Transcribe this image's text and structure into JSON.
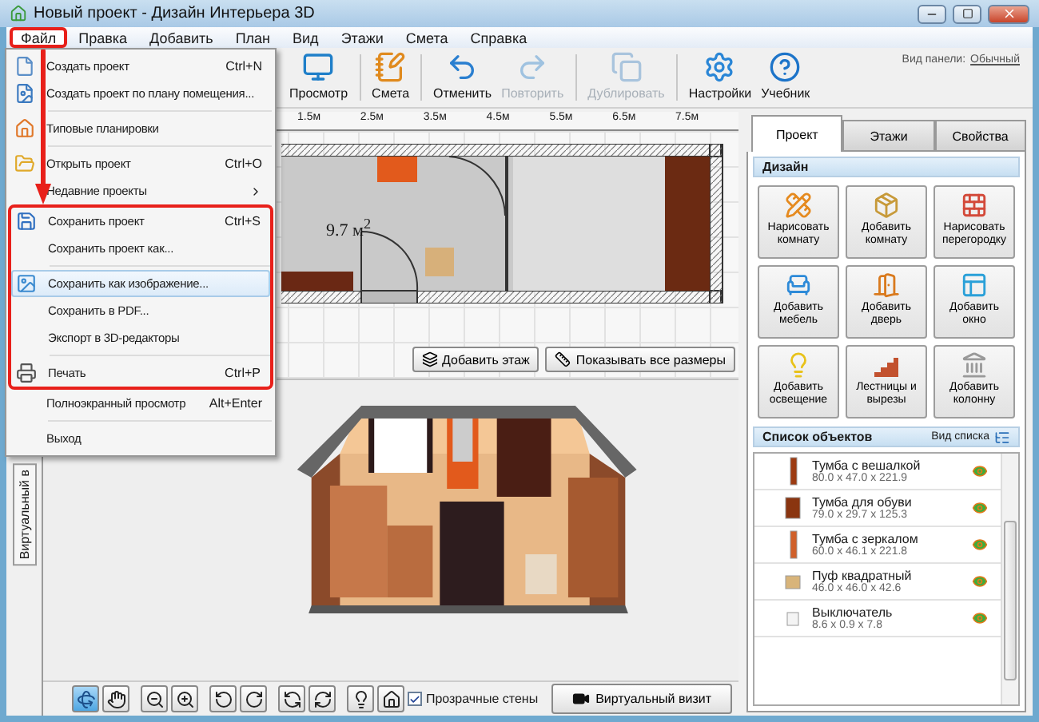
{
  "window": {
    "title": "Новый проект - Дизайн Интерьера 3D"
  },
  "menu_bar": [
    {
      "label": "Файл",
      "selected": true,
      "framed": true
    },
    {
      "label": "Правка",
      "selected": false,
      "framed": false
    },
    {
      "label": "Добавить",
      "selected": false,
      "framed": false
    },
    {
      "label": "План",
      "selected": false,
      "framed": false
    },
    {
      "label": "Вид",
      "selected": false,
      "framed": false
    },
    {
      "label": "Этажи",
      "selected": false,
      "framed": false
    },
    {
      "label": "Смета",
      "selected": false,
      "framed": false
    },
    {
      "label": "Справка",
      "selected": false,
      "framed": false
    }
  ],
  "toolbar": {
    "buttons": [
      {
        "kind": "monitor",
        "label": "Просмотр",
        "disabled": false
      },
      {
        "kind": "notepad",
        "label": "Смета",
        "disabled": false
      },
      {
        "kind": "undo",
        "label": "Отменить",
        "disabled": false
      },
      {
        "kind": "redo",
        "label": "Повторить",
        "disabled": true
      },
      {
        "kind": "copy",
        "label": "Дублировать",
        "disabled": true
      },
      {
        "kind": "gear",
        "label": "Настройки",
        "disabled": false
      },
      {
        "kind": "help",
        "label": "Учебник",
        "disabled": false
      }
    ],
    "panel_view_label": "Вид панели:",
    "panel_view_link": "Обычный"
  },
  "file_menu": {
    "sections": [
      {
        "framed": false,
        "items": [
          {
            "kind": "new",
            "label": "Создать проект",
            "shortcut": "Ctrl+N",
            "selected": false
          },
          {
            "kind": "plan",
            "label": "Создать проект по плану помещения...",
            "selected": false
          },
          {
            "kind": "separator"
          },
          {
            "kind": "templates",
            "label": "Типовые планировки",
            "selected": false
          },
          {
            "kind": "separator"
          },
          {
            "kind": "open",
            "label": "Открыть проект",
            "shortcut": "Ctrl+O",
            "selected": false
          },
          {
            "kind": "submenu",
            "label": "Недавние проекты",
            "selected": false
          }
        ]
      },
      {
        "framed": true,
        "items": [
          {
            "kind": "save",
            "label": "Сохранить проект",
            "shortcut": "Ctrl+S",
            "selected": false
          },
          {
            "kind": "plain",
            "label": "Сохранить проект как...",
            "selected": false
          },
          {
            "kind": "separator"
          },
          {
            "kind": "image",
            "label": "Сохранить как изображение...",
            "selected": true
          },
          {
            "kind": "plain",
            "label": "Сохранить в  PDF...",
            "selected": false
          },
          {
            "kind": "plain",
            "label": "Экспорт в 3D-редакторы",
            "selected": false
          },
          {
            "kind": "separator"
          },
          {
            "kind": "print",
            "label": "Печать",
            "shortcut": "Ctrl+P",
            "selected": false
          }
        ]
      },
      {
        "framed": false,
        "items": [
          {
            "kind": "plain",
            "label": "Полноэкранный просмотр",
            "shortcut": "Alt+Enter",
            "selected": false
          },
          {
            "kind": "separator"
          },
          {
            "kind": "plain",
            "label": "Выход",
            "selected": false
          }
        ]
      }
    ]
  },
  "ruler": {
    "labels": [
      "1.5м",
      "2.5м",
      "3.5м",
      "4.5м",
      "5.5м",
      "6.5м",
      "7.5м"
    ]
  },
  "plan": {
    "area_label": "9.7 м$^{2}$",
    "buttons": [
      {
        "kind": "floor",
        "label": "Добавить этаж"
      },
      {
        "kind": "sizes",
        "label": "Показывать все размеры"
      }
    ]
  },
  "view_3d": {
    "side_tab": "Виртуальный в",
    "tools": [
      {
        "kind": "rotate",
        "selected": true
      },
      {
        "kind": "hand",
        "selected": false
      },
      {
        "kind": "zoomout",
        "selected": false
      },
      {
        "kind": "zoomin",
        "selected": false
      },
      {
        "kind": "turnleft",
        "selected": false
      },
      {
        "kind": "turnright",
        "selected": false
      },
      {
        "kind": "tiltup",
        "selected": false
      },
      {
        "kind": "tiltdown",
        "selected": false
      },
      {
        "kind": "light",
        "selected": false
      },
      {
        "kind": "home",
        "selected": false
      }
    ],
    "transparent_walls": {
      "label": "Прозрачные стены",
      "checked": true
    },
    "visit_button": "Виртуальный визит"
  },
  "right_panel": {
    "tabs": [
      {
        "label": "Проект",
        "selected": true
      },
      {
        "label": "Этажи",
        "selected": false
      },
      {
        "label": "Свойства",
        "selected": false
      }
    ],
    "design_title": "Дизайн",
    "design_buttons": [
      {
        "kind": "pencils",
        "label": "Нарисовать комнату"
      },
      {
        "kind": "box",
        "label": "Добавить комнату"
      },
      {
        "kind": "bricks",
        "label": "Нарисовать перегородку"
      },
      {
        "kind": "chair",
        "label": "Добавить мебель"
      },
      {
        "kind": "door",
        "label": "Добавить дверь"
      },
      {
        "kind": "window",
        "label": "Добавить окно"
      },
      {
        "kind": "bulb",
        "label": "Добавить освещение"
      },
      {
        "kind": "stairs",
        "label": "Лестницы и вырезы"
      },
      {
        "kind": "column",
        "label": "Добавить колонну"
      }
    ],
    "objects_title": "Список объектов",
    "list_view_label": "Вид списка",
    "objects": [
      {
        "kind": "tall",
        "name": "Тумба с вешалкой",
        "dims": "80.0 x 47.0 x 221.9"
      },
      {
        "kind": "chest",
        "name": "Тумба для обуви",
        "dims": "79.0 x 29.7 x 125.3"
      },
      {
        "kind": "mirror",
        "name": "Тумба с зеркалом",
        "dims": "60.0 x 46.1 x 221.8"
      },
      {
        "kind": "pouf",
        "name": "Пуф квадратный",
        "dims": "46.0 x 46.0 x 42.6"
      },
      {
        "kind": "switch",
        "name": "Выключатель",
        "dims": "8.6 x 0.9 x 7.8"
      }
    ]
  }
}
